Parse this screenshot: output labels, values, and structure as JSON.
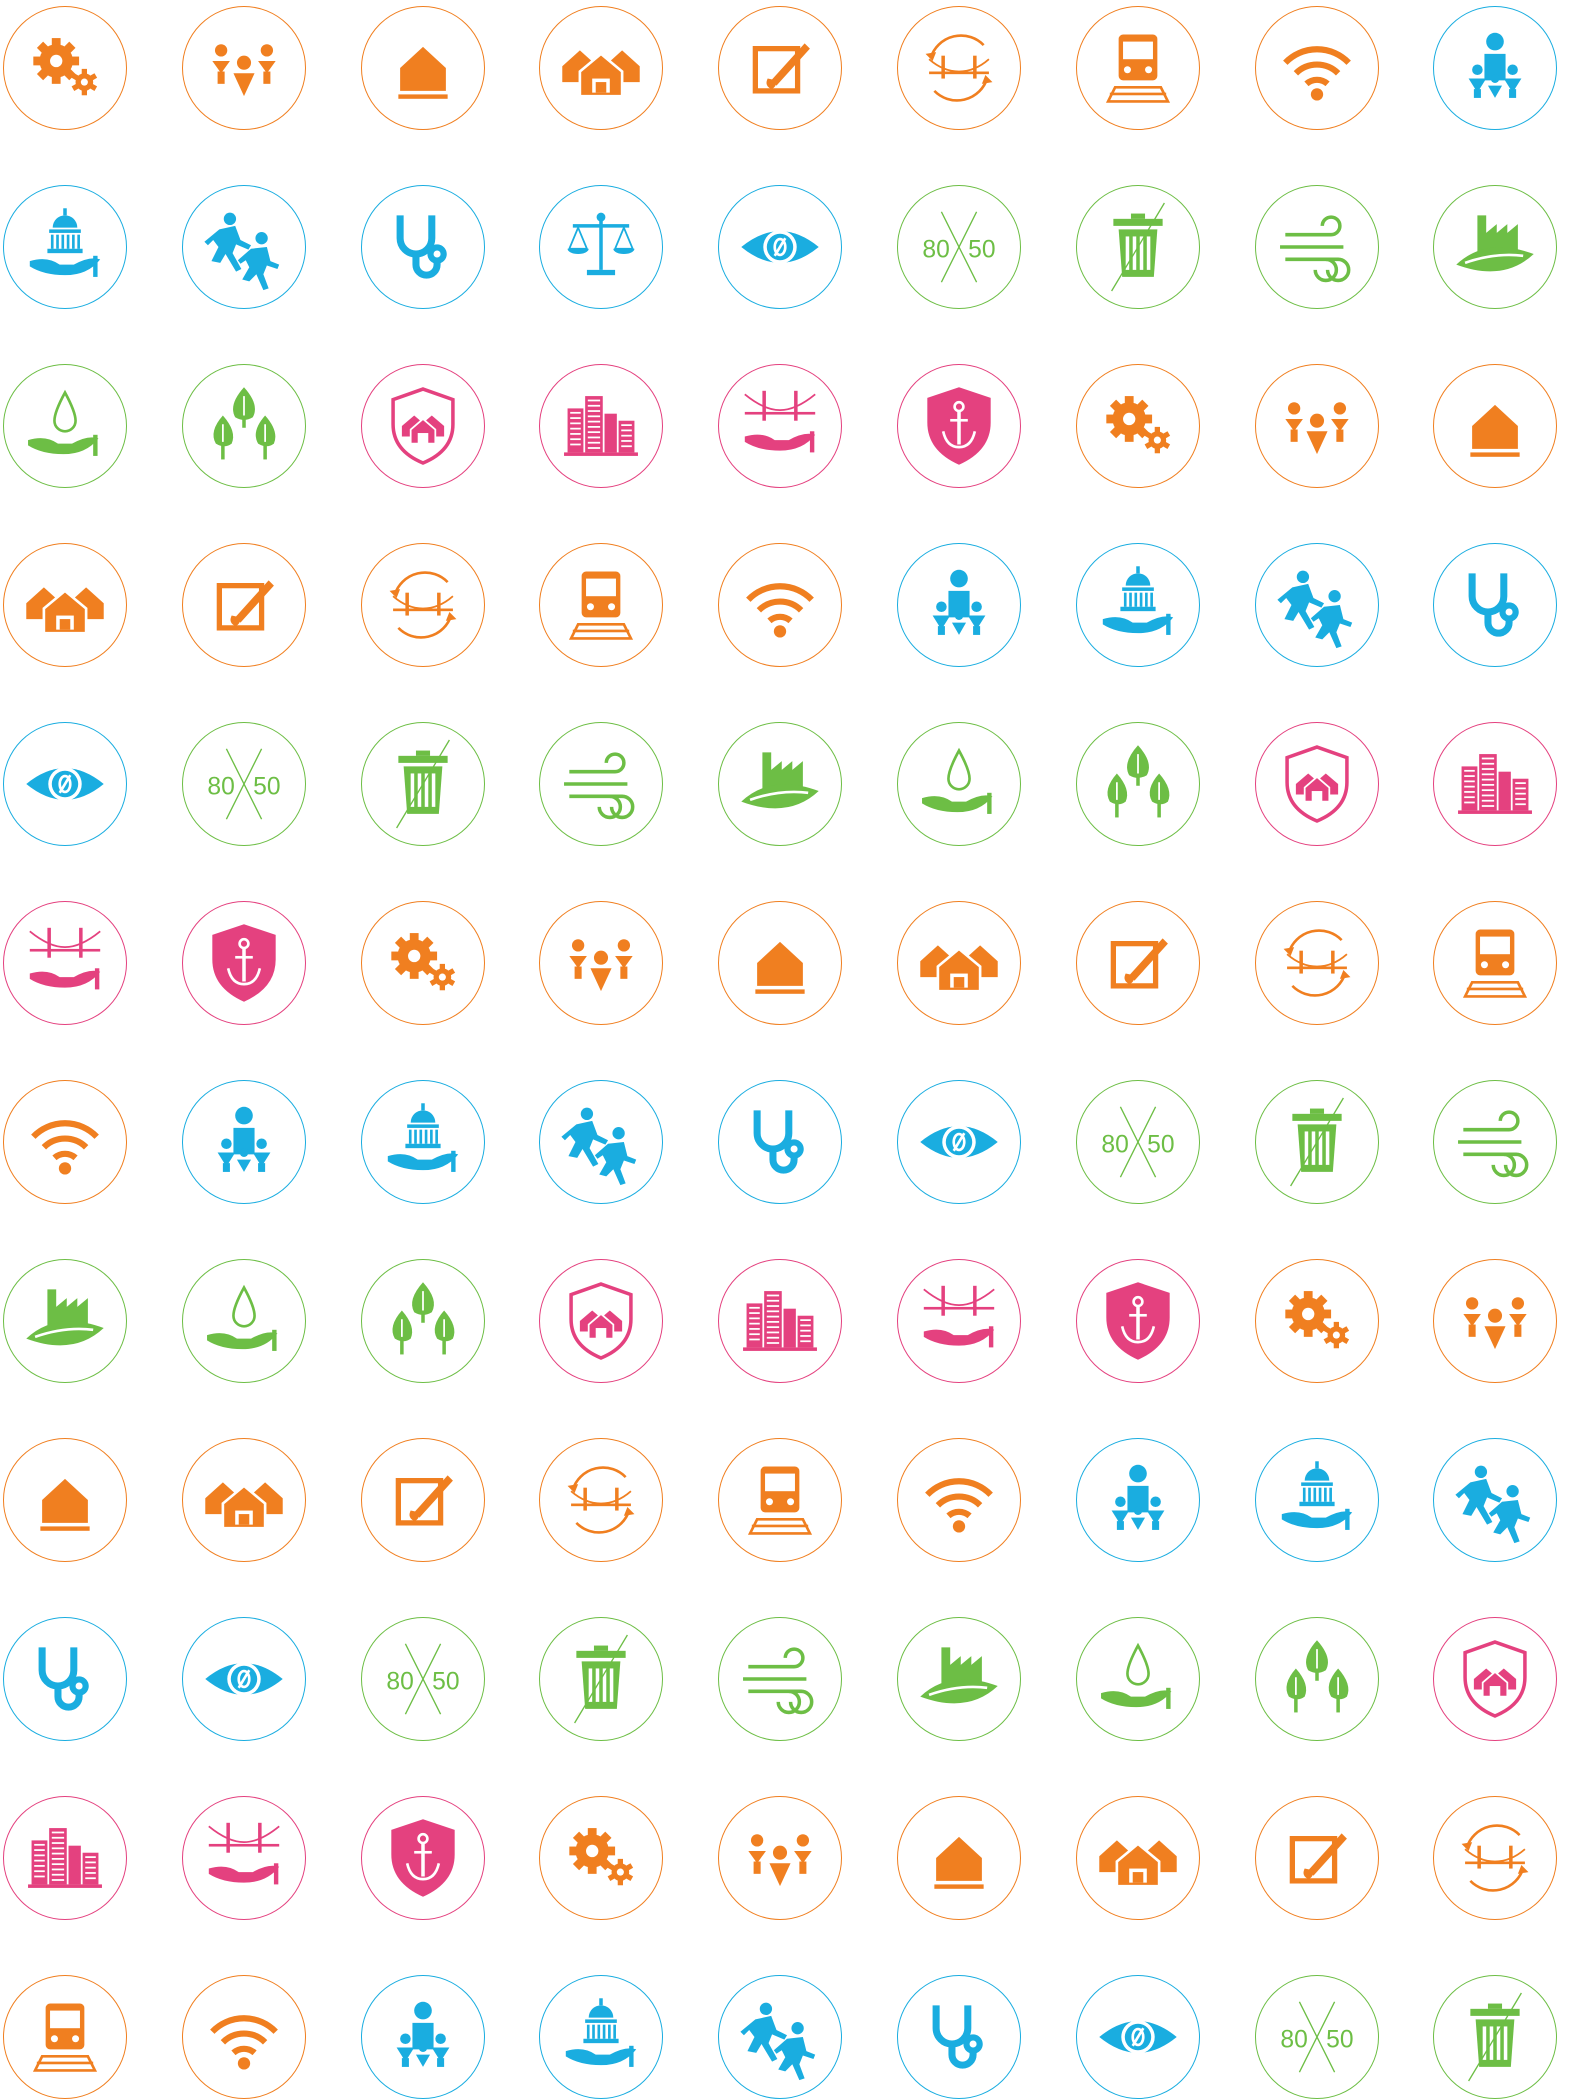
{
  "colors": {
    "orange": "#F07F20",
    "blue": "#1AADE0",
    "green": "#6DBE45",
    "pink": "#E4417F"
  },
  "grid": {
    "columns": 9,
    "rows": 12
  },
  "icon_cycle": [
    {
      "name": "gears-icon",
      "color": "orange"
    },
    {
      "name": "people-group-icon",
      "color": "orange"
    },
    {
      "name": "house-icon",
      "color": "orange"
    },
    {
      "name": "houses-icon",
      "color": "orange"
    },
    {
      "name": "art-easel-icon",
      "color": "orange"
    },
    {
      "name": "bridge-cycle-icon",
      "color": "orange"
    },
    {
      "name": "train-icon",
      "color": "orange"
    },
    {
      "name": "wifi-icon",
      "color": "orange"
    },
    {
      "name": "family-icon",
      "color": "blue"
    },
    {
      "name": "capitol-hand-icon",
      "color": "blue"
    },
    {
      "name": "runners-icon",
      "color": "blue"
    },
    {
      "name": "stethoscope-icon",
      "color": "blue"
    },
    {
      "name": "justice-scales-icon",
      "color": "blue"
    },
    {
      "name": "eye-zero-icon",
      "color": "blue"
    },
    {
      "name": "80x50-icon",
      "color": "green",
      "text_left": "80",
      "text_right": "50"
    },
    {
      "name": "trash-can-icon",
      "color": "green"
    },
    {
      "name": "wind-icon",
      "color": "green"
    },
    {
      "name": "factory-leaf-icon",
      "color": "green"
    },
    {
      "name": "water-hand-icon",
      "color": "green"
    },
    {
      "name": "trees-icon",
      "color": "green"
    },
    {
      "name": "shield-houses-icon",
      "color": "pink"
    },
    {
      "name": "city-buildings-icon",
      "color": "pink"
    },
    {
      "name": "bridge-hand-icon",
      "color": "pink"
    },
    {
      "name": "anchor-shield-icon",
      "color": "pink"
    }
  ],
  "sequence": [
    0,
    1,
    2,
    3,
    4,
    5,
    6,
    7,
    8,
    9,
    10,
    11,
    12,
    13,
    14,
    15,
    16,
    17,
    18,
    19,
    20,
    21,
    22,
    23,
    0,
    1,
    2,
    3,
    4,
    5,
    6,
    7,
    8,
    9,
    10,
    11,
    13,
    14,
    15,
    16,
    17,
    18,
    19,
    20,
    21,
    22,
    23,
    0,
    1,
    2,
    3,
    4,
    5,
    6,
    7,
    8,
    9,
    10,
    11,
    13,
    14,
    15,
    16,
    17,
    18,
    19,
    20,
    21,
    22,
    23,
    0,
    1,
    2,
    3,
    4,
    5,
    6,
    7,
    8,
    9,
    10,
    11,
    13,
    14,
    15,
    16,
    17,
    18,
    19,
    20,
    21,
    22,
    23,
    0,
    1,
    2,
    3,
    4,
    5,
    6,
    7,
    8,
    9,
    10,
    11,
    13,
    14,
    15
  ]
}
